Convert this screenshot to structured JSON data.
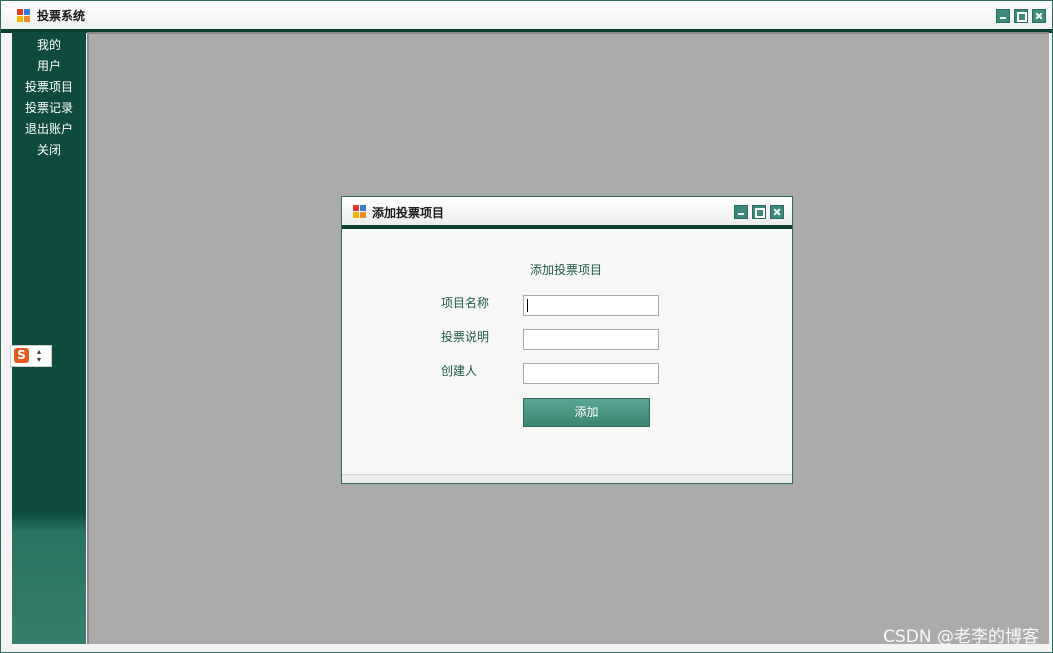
{
  "window": {
    "title": "投票系统"
  },
  "sidebar": {
    "items": [
      {
        "label": "我的"
      },
      {
        "label": "用户"
      },
      {
        "label": "投票项目"
      },
      {
        "label": "投票记录"
      },
      {
        "label": "退出账户"
      },
      {
        "label": "关闭"
      }
    ]
  },
  "dialog": {
    "title": "添加投票项目",
    "heading": "添加投票项目",
    "fields": [
      {
        "label": "项目名称",
        "value": ""
      },
      {
        "label": "投票说明",
        "value": ""
      },
      {
        "label": "创建人",
        "value": ""
      }
    ],
    "submit_label": "添加"
  },
  "ime": {
    "logo": "S"
  },
  "watermark": "CSDN @老李的博客",
  "colors": {
    "accent": "#0e4a3e",
    "button": "#3b8472",
    "mdi_bg": "#ababab",
    "label_text": "#1e5a4c"
  }
}
